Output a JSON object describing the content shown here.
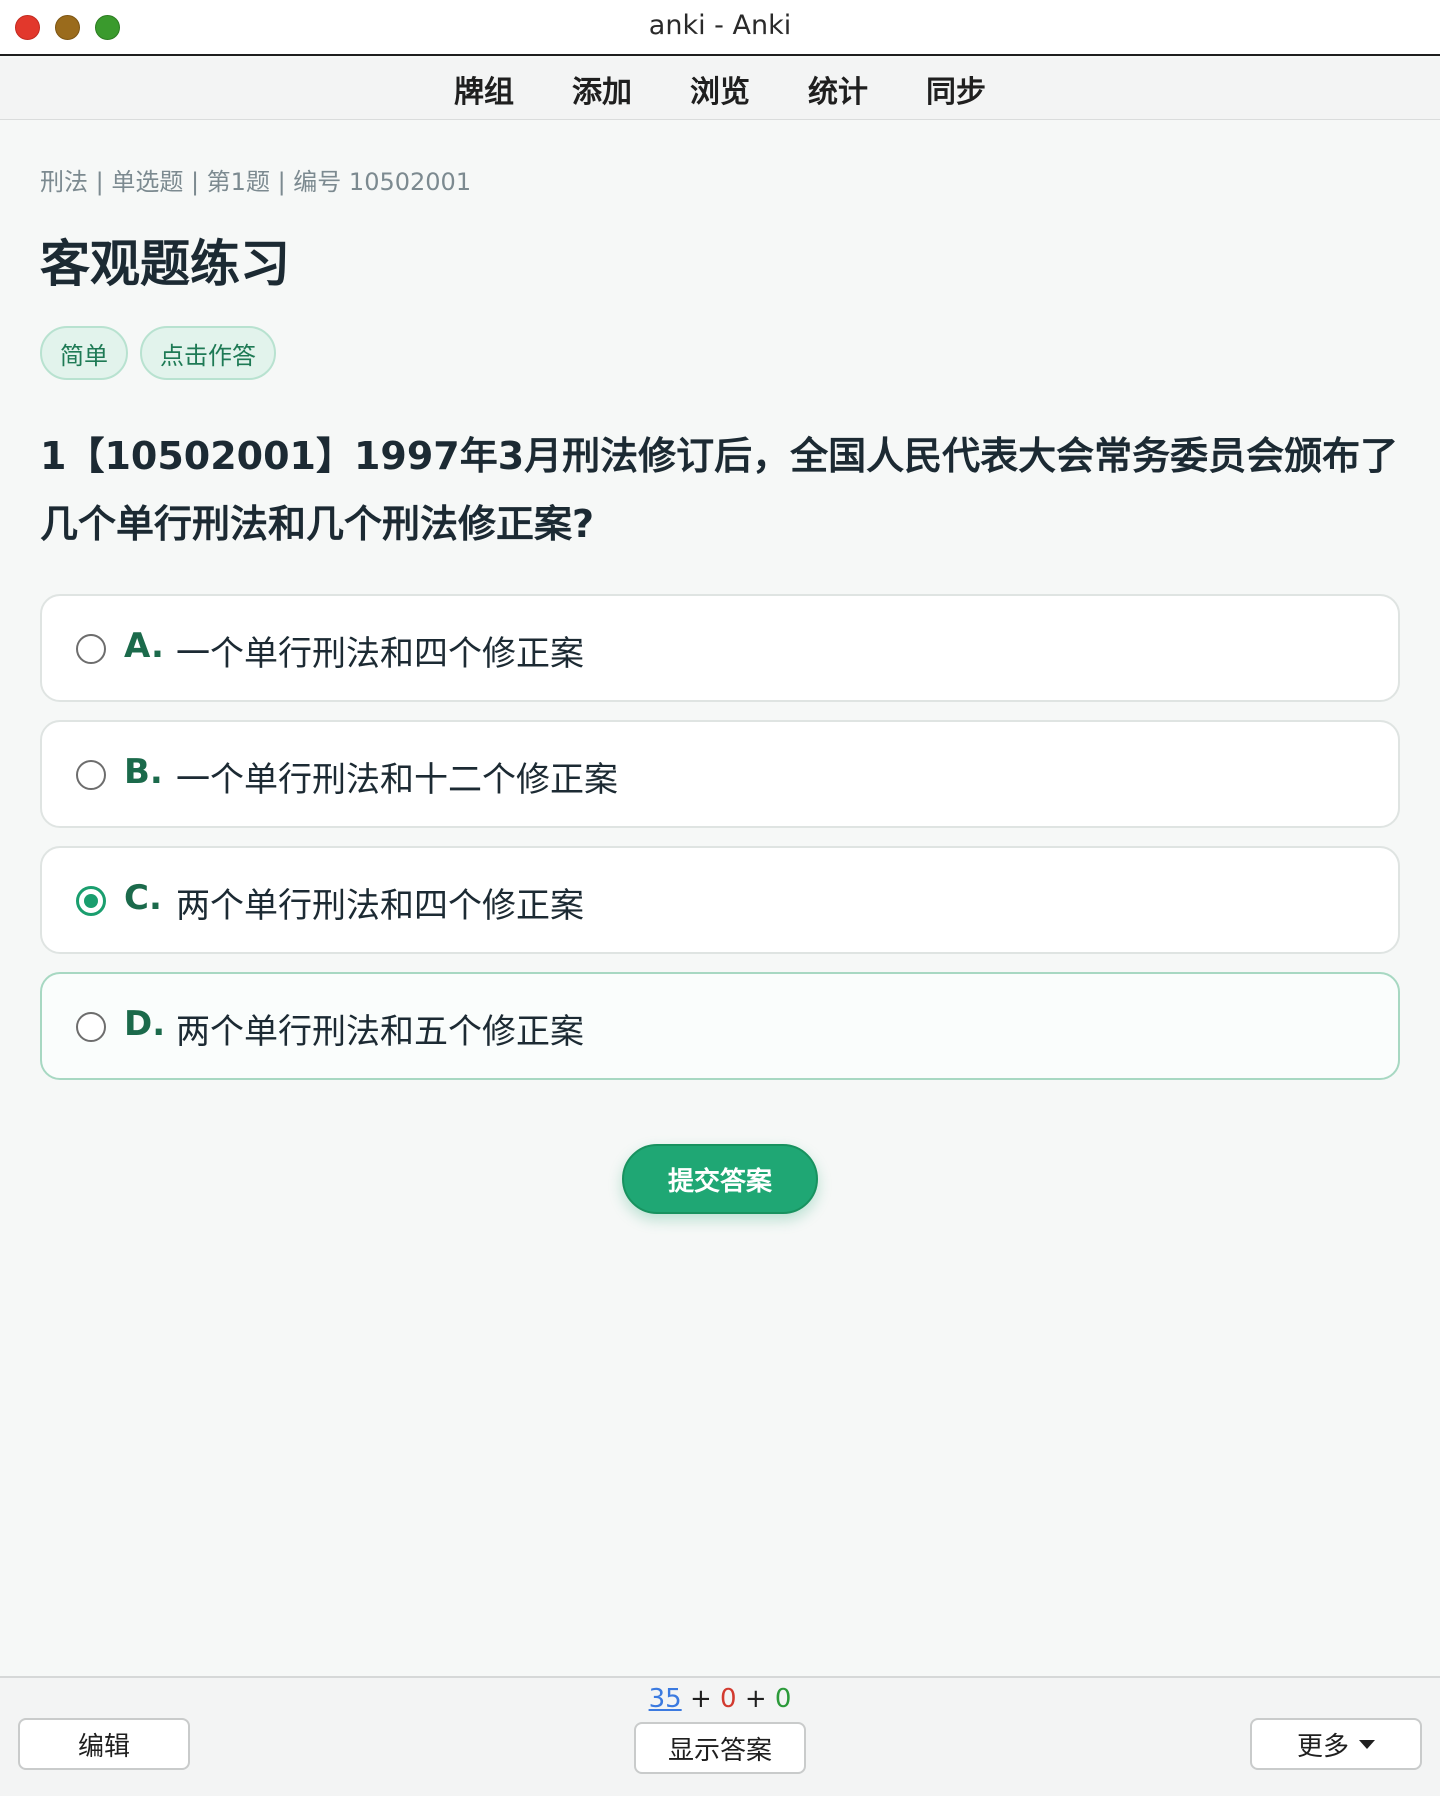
{
  "window": {
    "title": "anki - Anki"
  },
  "menu": {
    "items": [
      "牌组",
      "添加",
      "浏览",
      "统计",
      "同步"
    ]
  },
  "card": {
    "breadcrumb": "刑法 | 单选题 | 第1题 | 编号 10502001",
    "title": "客观题练习",
    "tags": [
      "简单",
      "点击作答"
    ],
    "question": "1【10502001】1997年3月刑法修订后，全国人民代表大会常务委员会颁布了几个单行刑法和几个刑法修正案?",
    "options": [
      {
        "letter": "A.",
        "text": "一个单行刑法和四个修正案",
        "selected": false
      },
      {
        "letter": "B.",
        "text": "一个单行刑法和十二个修正案",
        "selected": false
      },
      {
        "letter": "C.",
        "text": "两个单行刑法和四个修正案",
        "selected": true
      },
      {
        "letter": "D.",
        "text": "两个单行刑法和五个修正案",
        "selected": false
      }
    ],
    "submit_label": "提交答案",
    "accent_color": "#1fa774"
  },
  "bottom": {
    "edit_label": "编辑",
    "show_answer_label": "显示答案",
    "more_label": "更多",
    "counts": {
      "new": "35",
      "learn": "0",
      "review": "0",
      "sep": "+"
    }
  }
}
